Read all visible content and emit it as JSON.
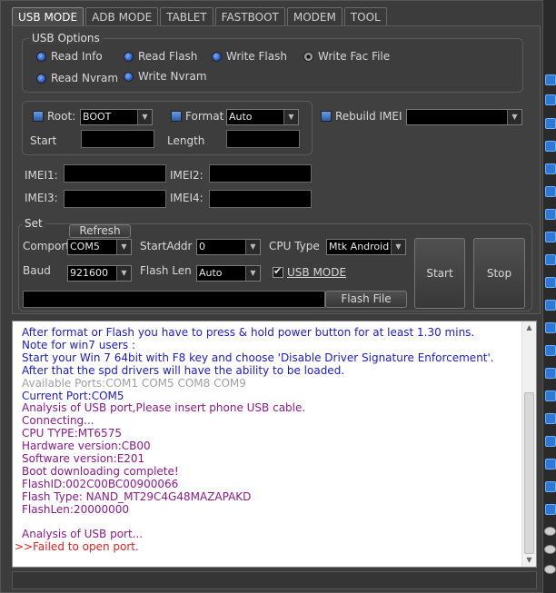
{
  "tabs": [
    "USB MODE",
    "ADB MODE",
    "TABLET",
    "FASTBOOT",
    "MODEM",
    "TOOL"
  ],
  "usb_options": {
    "title": "USB Options",
    "read_info": "Read Info",
    "read_flash": "Read Flash",
    "write_flash": "Write Flash",
    "write_fac_file": "Write Fac File",
    "read_nvram": "Read Nvram",
    "write_nvram": "Write Nvram"
  },
  "flash_opts": {
    "root_label": "Root:",
    "root_value": "BOOT",
    "format_label": "Format",
    "format_value": "Auto",
    "rebuild_imei_label": "Rebuild IMEI",
    "rebuild_imei_value": "",
    "start_label": "Start",
    "start_value": "",
    "length_label": "Length",
    "length_value": ""
  },
  "imei": {
    "imei1_label": "IMEI1:",
    "imei2_label": "IMEI2:",
    "imei3_label": "IMEI3:",
    "imei4_label": "IMEI4:"
  },
  "set": {
    "title": "Set",
    "refresh": "Refresh",
    "comport_label": "Comport",
    "comport_value": "COM5",
    "startaddr_label": "StartAddr",
    "startaddr_value": "0",
    "cpu_type_label": "CPU Type",
    "cpu_type_value": "Mtk Android",
    "baud_label": "Baud",
    "baud_value": "921600",
    "flash_len_label": "Flash Len",
    "flash_len_value": "Auto",
    "usb_mode_label": "USB MODE",
    "flash_file": "Flash File",
    "start": "Start",
    "stop": "Stop"
  },
  "log": [
    {
      "text": "After format or Flash you have to press & hold power button for at least 1.30 mins.",
      "color": "#1a1ad0"
    },
    {
      "text": "Note for win7 users :",
      "color": "#1a1ad0"
    },
    {
      "text": "Start your Win 7 64bit with F8 key and choose 'Disable Driver Signature Enforcement'.",
      "color": "#1a1ad0"
    },
    {
      "text": "After that the spd drivers will have the ability to be loaded.",
      "color": "#1a1ad0"
    },
    {
      "text": "Available Ports:COM1 COM5 COM8 COM9",
      "color": "#a0a0a0"
    },
    {
      "text": "Current Port:COM5",
      "color": "#1a1ad0"
    },
    {
      "text": "Analysis of USB port,Please insert phone USB cable.",
      "color": "#8a1a8a"
    },
    {
      "text": "Connecting...",
      "color": "#8a1a8a"
    },
    {
      "text": "CPU TYPE:MT6575",
      "color": "#8a1a8a"
    },
    {
      "text": "Hardware version:CB00",
      "color": "#8a1a8a"
    },
    {
      "text": "Software version:E201",
      "color": "#8a1a8a"
    },
    {
      "text": "Boot downloading complete!",
      "color": "#8a1a8a"
    },
    {
      "text": "FlashID:002C00BC00900066",
      "color": "#8a1a8a"
    },
    {
      "text": "Flash Type: NAND_MT29C4G48MAZAPAKD",
      "color": "#8a1a8a"
    },
    {
      "text": "FlashLen:20000000",
      "color": "#8a1a8a"
    },
    {
      "text": "",
      "color": "#8a1a8a"
    },
    {
      "text": "Analysis of USB port...",
      "color": "#8a1a8a"
    },
    {
      "text": ">>Failed to open port.",
      "color": "#e02020"
    }
  ]
}
